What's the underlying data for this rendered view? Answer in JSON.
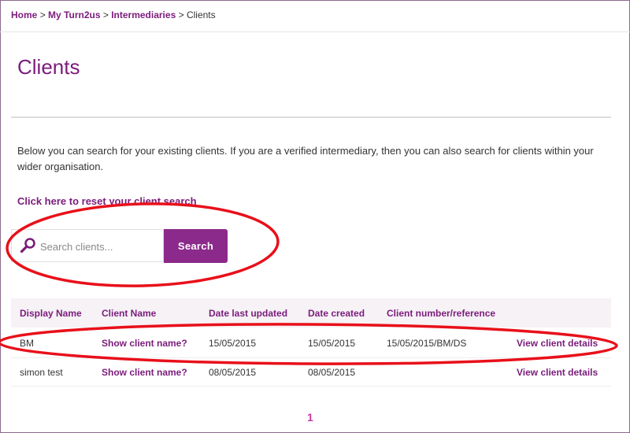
{
  "breadcrumb": {
    "items": [
      "Home",
      "My Turn2us",
      "Intermediaries"
    ],
    "current": "Clients",
    "separator": ">"
  },
  "page": {
    "title": "Clients",
    "intro": "Below you can search for your existing clients. If you are a verified intermediary, then you can also search for clients within your wider organisation.",
    "reset_link": "Click here to reset your client search"
  },
  "search": {
    "placeholder": "Search clients...",
    "value": "",
    "button_label": "Search",
    "icon": "search-icon"
  },
  "table": {
    "headers": [
      "Display Name",
      "Client Name",
      "Date last updated",
      "Date created",
      "Client number/reference"
    ],
    "rows": [
      {
        "display_name": "BM",
        "client_name_link": "Show client name?",
        "date_last_updated": "15/05/2015",
        "date_created": "15/05/2015",
        "client_reference": "15/05/2015/BM/DS",
        "details_link": "View client details"
      },
      {
        "display_name": "simon test",
        "client_name_link": "Show client name?",
        "date_last_updated": "08/05/2015",
        "date_created": "08/05/2015",
        "client_reference": "",
        "details_link": "View client details"
      }
    ]
  },
  "pagination": {
    "pages": [
      "1"
    ],
    "current": "1"
  },
  "colors": {
    "brand_purple": "#7b1c7b",
    "button_purple": "#8b2a8b",
    "annotation_red": "#e8101a"
  }
}
